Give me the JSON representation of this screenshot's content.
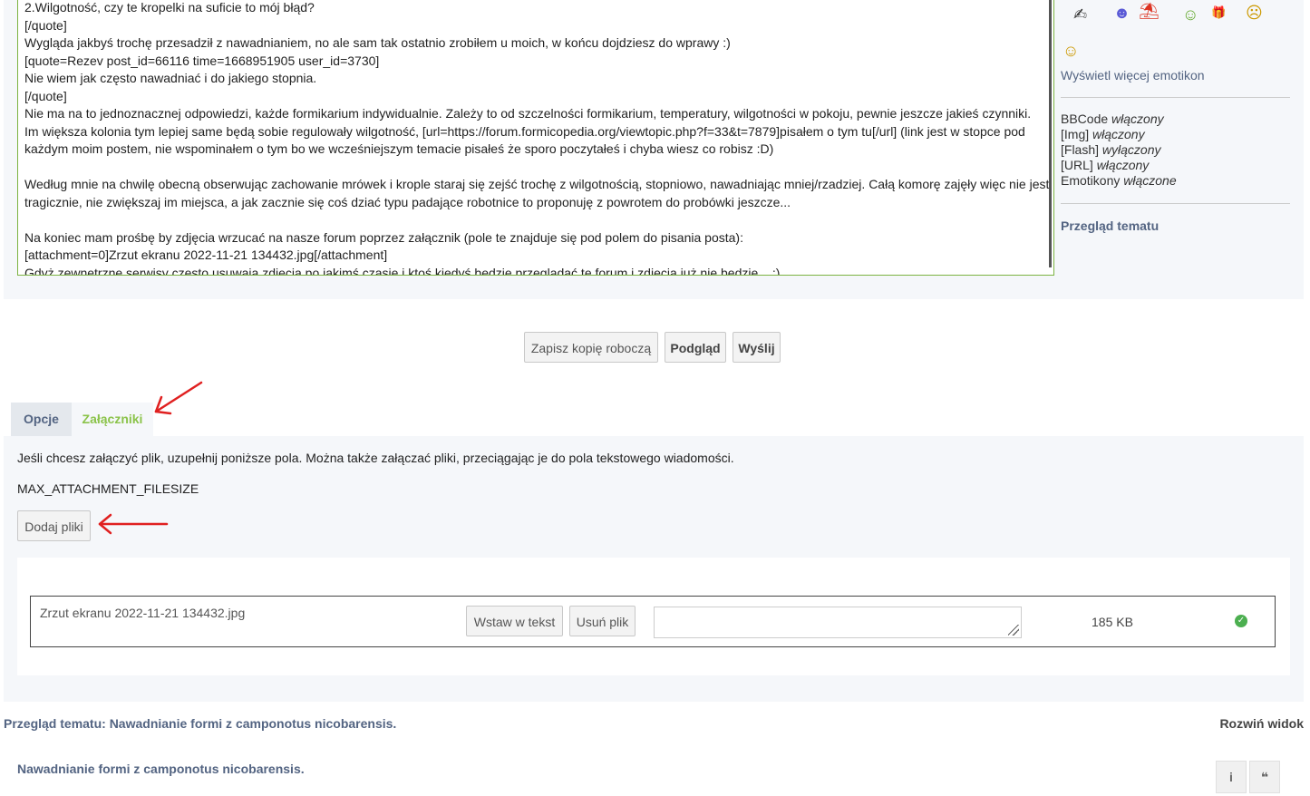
{
  "editor": {
    "lines": [
      "2.Wilgotność, czy te kropelki na suficie to mój błąd?",
      "[/quote]",
      "Wygląda jakbyś trochę przesadził z nawadnianiem, no ale sam tak ostatnio zrobiłem u moich, w końcu dojdziesz do wprawy :)",
      "[quote=Rezev post_id=66116 time=1668951905 user_id=3730]",
      "Nie wiem jak często nawadniać i do jakiego stopnia.",
      "[/quote]",
      "Nie ma na to jednoznacznej odpowiedzi, każde formikarium indywidualnie. Zależy to od szczelności formikarium, temperatury, wilgotności w pokoju, pewnie jeszcze jakieś czynniki.",
      "Im większa kolonia tym lepiej same będą sobie regulowały wilgotność, [url=https://forum.formicopedia.org/viewtopic.php?f=33&t=7879]pisałem o tym tu[/url] (link jest w stopce pod każdym moim postem, nie wspominałem o tym bo we wcześniejszym temacie pisałeś że sporo poczytałeś i chyba wiesz co robisz  :D)",
      "",
      "Według mnie na chwilę obecną obserwując zachowanie mrówek i krople staraj się zejść trochę z wilgotnością, stopniowo, nawadniając mniej/rzadziej. Całą komorę zajęły więc nie jest tragicznie, nie zwiększaj im miejsca, a jak zacznie się coś dziać typu padające robotnice to proponuję z powrotem do probówki jeszcze...",
      "",
      "Na koniec mam prośbę by zdjęcia wrzucać na nasze forum poprzez załącznik (pole te znajduje się pod polem do pisania posta):",
      "[attachment=0]Zrzut ekranu 2022-11-21 134432.jpg[/attachment]",
      "Gdyż zewnętrzne serwisy często usuwają zdjęcia po jakimś czasie i ktoś kiedyś będzie przeglądać te forum i zdjęcia już nie będzie... ;)"
    ]
  },
  "sidebar": {
    "more_emoticons": "Wyświetl więcej emotikon",
    "flags": [
      {
        "label": "BBCode",
        "state": "włączony"
      },
      {
        "label": "[Img]",
        "state": "włączony"
      },
      {
        "label": "[Flash]",
        "state": "wyłączony"
      },
      {
        "label": "[URL]",
        "state": "włączony"
      },
      {
        "label": "Emotikony",
        "state": "włączone"
      }
    ],
    "topic_review": "Przegląd tematu"
  },
  "buttons": {
    "save_draft": "Zapisz kopię roboczą",
    "preview": "Podgląd",
    "submit": "Wyślij"
  },
  "tabs": {
    "options": "Opcje",
    "attachments": "Załączniki"
  },
  "attachments": {
    "info": "Jeśli chcesz załączyć plik, uzupełnij poniższe pola. Można także załączać pliki, przeciągając je do pola tekstowego wiadomości.",
    "max_size": "MAX_ATTACHMENT_FILESIZE",
    "add_files": "Dodaj pliki",
    "file": {
      "name": "Zrzut ekranu 2022-11-21 134432.jpg",
      "insert": "Wstaw w tekst",
      "remove": "Usuń plik",
      "size": "185 KB"
    }
  },
  "review": {
    "title": "Przegląd tematu: Nawadnianie formi z camponotus nicobarensis.",
    "expand": "Rozwiń widok",
    "post_title": "Nawadnianie formi z camponotus nicobarensis.",
    "info_btn": "i",
    "quote_btn": "❝"
  },
  "colors": {
    "accent_green": "#8bc34a",
    "link_blue": "#536482",
    "annotation_red": "#e02020"
  }
}
